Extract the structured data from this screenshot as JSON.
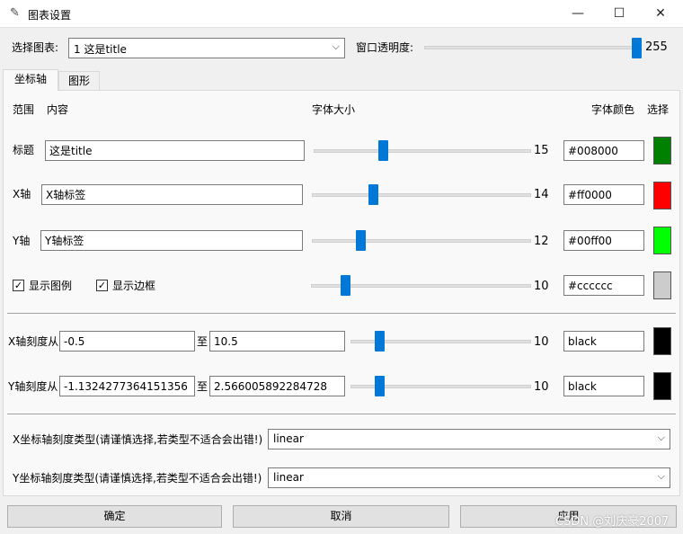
{
  "window": {
    "title": "图表设置",
    "icon": "feather-icon",
    "controls": {
      "minimize": "—",
      "maximize": "☐",
      "close": "✕"
    }
  },
  "top": {
    "select_chart_label": "选择图表:",
    "select_chart_value": "1  这是title",
    "opacity_label": "窗口透明度:",
    "opacity_value": "255",
    "opacity_level_fraction": 1.0
  },
  "tabs": [
    {
      "label": "坐标轴",
      "active": true
    },
    {
      "label": "图形",
      "active": false
    }
  ],
  "headers": {
    "scope": "范围",
    "content": "内容",
    "font_size": "字体大小",
    "font_color": "字体颜色",
    "choose": "选择"
  },
  "rows": {
    "title": {
      "label": "标题",
      "value": "这是title",
      "size": "15",
      "color_text": "#008000",
      "swatch": "#008000",
      "level": 0.31
    },
    "xaxis": {
      "label": "X轴",
      "value": "X轴标签",
      "size": "14",
      "color_text": "#ff0000",
      "swatch": "#ff0000",
      "level": 0.27
    },
    "yaxis": {
      "label": "Y轴",
      "value": "Y轴标签",
      "size": "12",
      "color_text": "#00ff00",
      "swatch": "#00ff00",
      "level": 0.21
    },
    "legend": {
      "show_legend": "显示图例",
      "show_border": "显示边框",
      "size": "10",
      "color_text": "#cccccc",
      "swatch": "#cccccc",
      "level": 0.14
    }
  },
  "ticks": {
    "x": {
      "label": "X轴刻度从",
      "from": "-0.5",
      "to_label": "至",
      "to": "10.5",
      "size": "10",
      "color_text": "black",
      "swatch": "#000000",
      "level": 0.14
    },
    "y": {
      "label": "Y轴刻度从",
      "from": "-1.1324277364151356",
      "to_label": "至",
      "to": "2.566005892284728",
      "size": "10",
      "color_text": "black",
      "swatch": "#000000",
      "level": 0.14
    }
  },
  "scale_types": {
    "x": {
      "label": "X坐标轴刻度类型(请谨慎选择,若类型不适合会出错!)",
      "value": "linear"
    },
    "y": {
      "label": "Y坐标轴刻度类型(请谨慎选择,若类型不适合会出错!)",
      "value": "linear"
    }
  },
  "buttons": {
    "ok": "确定",
    "cancel": "取消",
    "apply": "应用"
  },
  "watermark": "CSDN @刘庆豪2007"
}
